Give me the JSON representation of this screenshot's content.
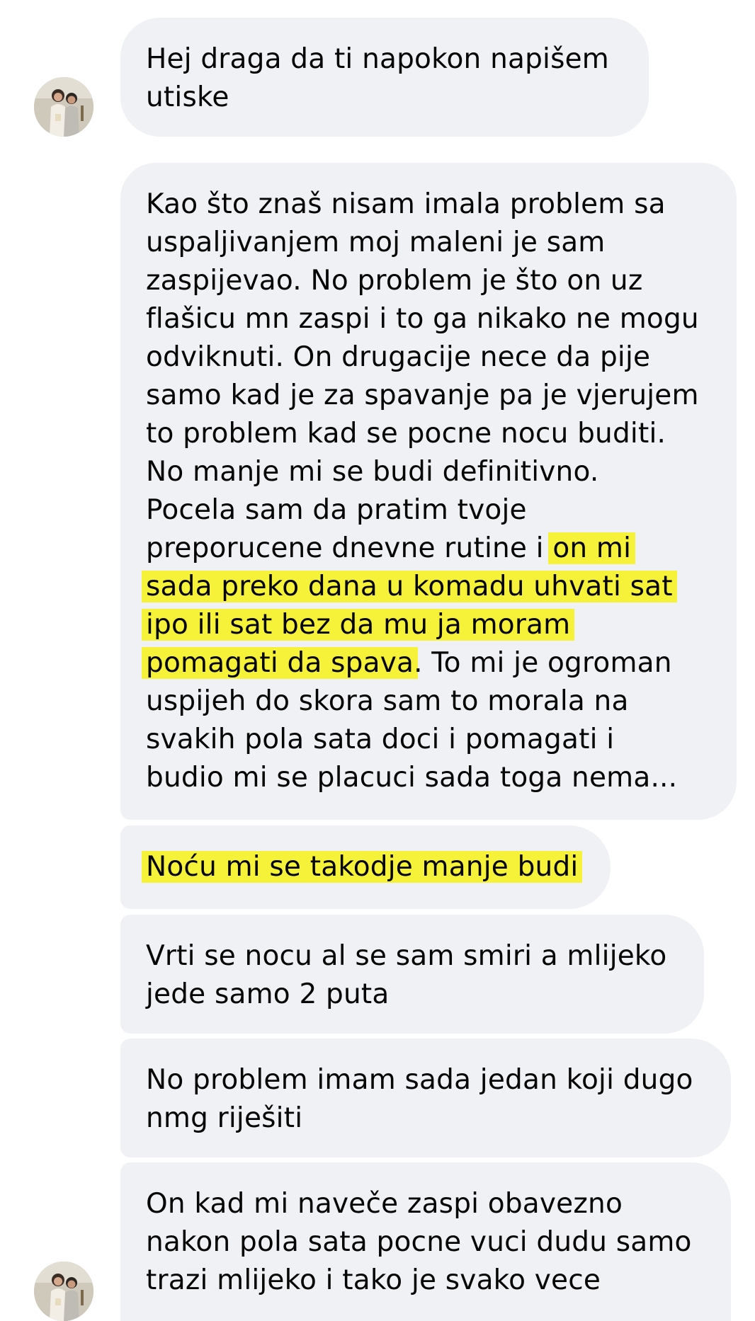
{
  "messages": [
    {
      "lines": [
        "Hej draga da ti napokon napišem",
        "utiske"
      ]
    },
    {
      "lines": [
        "Kao što znaš nisam imala problem sa",
        "uspaljivanjem moj maleni je sam",
        "zaspijevao. No problem je što on uz",
        "flašicu mn zaspi i to ga nikako ne mogu",
        "odviknuti. On drugacije nece da pije",
        "samo kad je za spavanje pa je vjerujem",
        "to problem kad se pocne nocu buditi.",
        "No manje mi se budi definitivno.",
        "Pocela sam da pratim tvoje"
      ],
      "line10_plain": "preporucene dnevne rutine i",
      "line10_highlight": "on mi",
      "highlight_lines": [
        "sada preko dana u komadu uhvati sat",
        "ipo ili sat bez da mu ja moram"
      ],
      "line13_highlight": "pomagati da spava",
      "line13_plain": ". To mi je ogroman",
      "tail_lines": [
        "uspijeh do skora sam to morala na",
        "svakih pola sata doci i pomagati i",
        "budio mi se placuci sada toga nema..."
      ]
    },
    {
      "highlight": "Noću mi se takodje manje budi"
    },
    {
      "lines": [
        "Vrti se nocu al se sam smiri a mlijeko",
        "jede samo 2 puta"
      ]
    },
    {
      "lines": [
        "No problem imam sada jedan koji dugo",
        "nmg riješiti"
      ]
    },
    {
      "lines": [
        "On kad mi naveče zaspi obavezno",
        "nakon pola sata pocne vuci dudu samo",
        "trazi mlijeko i tako je svako vece"
      ]
    }
  ],
  "colors": {
    "bubble": "#f0f1f4",
    "highlight": "#f6f139",
    "text": "#050505"
  },
  "icons": {
    "avatar": "sender-avatar-photo"
  }
}
